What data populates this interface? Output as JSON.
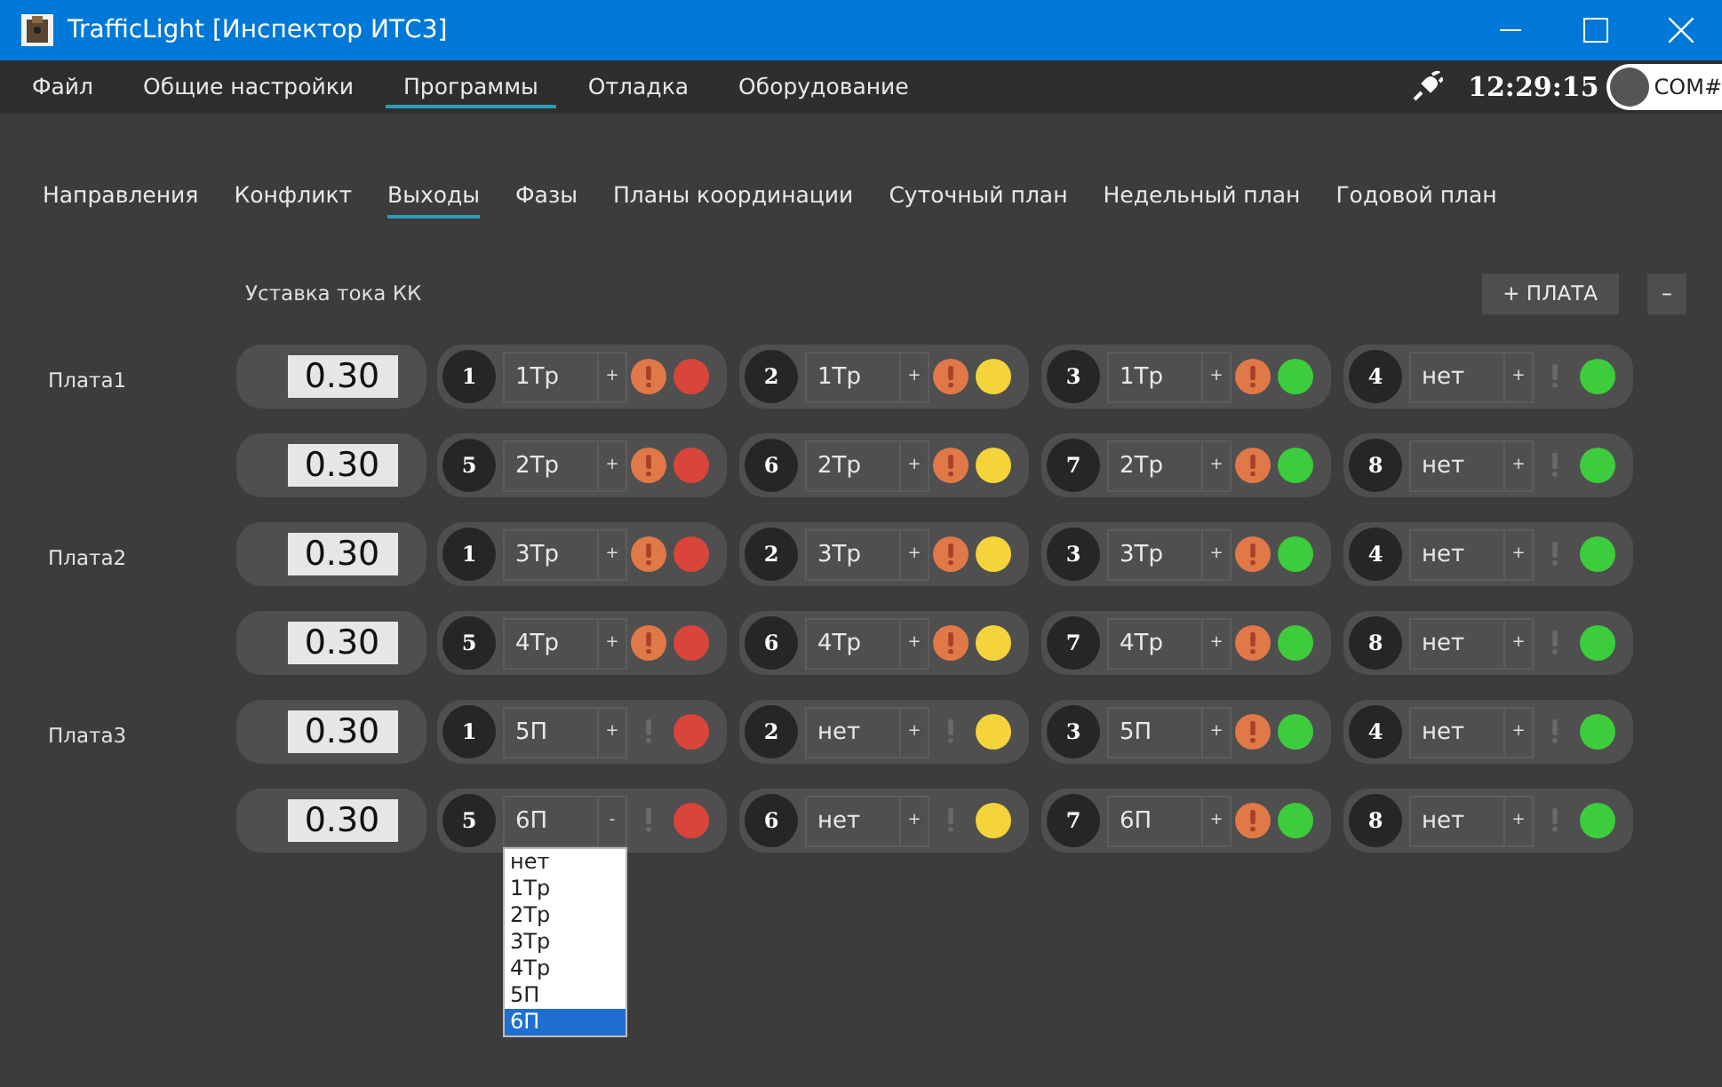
{
  "window": {
    "title": "TrafficLight [Инспектор ИТС3]"
  },
  "menu": [
    {
      "label": "Файл",
      "selected": false
    },
    {
      "label": "Общие настройки",
      "selected": false
    },
    {
      "label": "Программы",
      "selected": true
    },
    {
      "label": "Отладка",
      "selected": false
    },
    {
      "label": "Оборудование",
      "selected": false
    }
  ],
  "status": {
    "time": "12:29:15",
    "port": "COM#",
    "connected": false
  },
  "tabs": [
    {
      "label": "Направления",
      "selected": false
    },
    {
      "label": "Конфликт",
      "selected": false
    },
    {
      "label": "Выходы",
      "selected": true
    },
    {
      "label": "Фазы",
      "selected": false
    },
    {
      "label": "Планы координации",
      "selected": false
    },
    {
      "label": "Суточный план",
      "selected": false
    },
    {
      "label": "Недельный план",
      "selected": false
    },
    {
      "label": "Годовой план",
      "selected": false
    }
  ],
  "current_header": "Уставка тока КК",
  "buttons": {
    "add": "+ ПЛАТА",
    "remove": "–"
  },
  "boards": [
    {
      "label": "Плата1",
      "rows": [
        {
          "current": "0.30",
          "outputs": [
            {
              "num": "1",
              "value": "1Тр",
              "toggle": "+",
              "alarm": true,
              "color": "#d9453a"
            },
            {
              "num": "2",
              "value": "1Тр",
              "toggle": "+",
              "alarm": true,
              "color": "#f5d33a"
            },
            {
              "num": "3",
              "value": "1Тр",
              "toggle": "+",
              "alarm": true,
              "color": "#3ccc3c"
            },
            {
              "num": "4",
              "value": "нет",
              "toggle": "+",
              "alarm": false,
              "color": "#3ccc3c"
            }
          ]
        },
        {
          "current": "0.30",
          "outputs": [
            {
              "num": "5",
              "value": "2Тр",
              "toggle": "+",
              "alarm": true,
              "color": "#d9453a"
            },
            {
              "num": "6",
              "value": "2Тр",
              "toggle": "+",
              "alarm": true,
              "color": "#f5d33a"
            },
            {
              "num": "7",
              "value": "2Тр",
              "toggle": "+",
              "alarm": true,
              "color": "#3ccc3c"
            },
            {
              "num": "8",
              "value": "нет",
              "toggle": "+",
              "alarm": false,
              "color": "#3ccc3c"
            }
          ]
        }
      ]
    },
    {
      "label": "Плата2",
      "rows": [
        {
          "current": "0.30",
          "outputs": [
            {
              "num": "1",
              "value": "3Тр",
              "toggle": "+",
              "alarm": true,
              "color": "#d9453a"
            },
            {
              "num": "2",
              "value": "3Тр",
              "toggle": "+",
              "alarm": true,
              "color": "#f5d33a"
            },
            {
              "num": "3",
              "value": "3Тр",
              "toggle": "+",
              "alarm": true,
              "color": "#3ccc3c"
            },
            {
              "num": "4",
              "value": "нет",
              "toggle": "+",
              "alarm": false,
              "color": "#3ccc3c"
            }
          ]
        },
        {
          "current": "0.30",
          "outputs": [
            {
              "num": "5",
              "value": "4Тр",
              "toggle": "+",
              "alarm": true,
              "color": "#d9453a"
            },
            {
              "num": "6",
              "value": "4Тр",
              "toggle": "+",
              "alarm": true,
              "color": "#f5d33a"
            },
            {
              "num": "7",
              "value": "4Тр",
              "toggle": "+",
              "alarm": true,
              "color": "#3ccc3c"
            },
            {
              "num": "8",
              "value": "нет",
              "toggle": "+",
              "alarm": false,
              "color": "#3ccc3c"
            }
          ]
        }
      ]
    },
    {
      "label": "Плата3",
      "rows": [
        {
          "current": "0.30",
          "outputs": [
            {
              "num": "1",
              "value": "5П",
              "toggle": "+",
              "alarm": false,
              "color": "#d9453a"
            },
            {
              "num": "2",
              "value": "нет",
              "toggle": "+",
              "alarm": false,
              "color": "#f5d33a"
            },
            {
              "num": "3",
              "value": "5П",
              "toggle": "+",
              "alarm": true,
              "color": "#3ccc3c"
            },
            {
              "num": "4",
              "value": "нет",
              "toggle": "+",
              "alarm": false,
              "color": "#3ccc3c"
            }
          ]
        },
        {
          "current": "0.30",
          "outputs": [
            {
              "num": "5",
              "value": "6П",
              "toggle": "-",
              "alarm": false,
              "color": "#d9453a",
              "options": [
                {
                  "label": "нет",
                  "selected": false
                },
                {
                  "label": "1Тр",
                  "selected": false
                },
                {
                  "label": "2Тр",
                  "selected": false
                },
                {
                  "label": "3Тр",
                  "selected": false
                },
                {
                  "label": "4Тр",
                  "selected": false
                },
                {
                  "label": "5П",
                  "selected": false
                },
                {
                  "label": "6П",
                  "selected": true
                }
              ]
            },
            {
              "num": "6",
              "value": "нет",
              "toggle": "+",
              "alarm": false,
              "color": "#f5d33a"
            },
            {
              "num": "7",
              "value": "6П",
              "toggle": "+",
              "alarm": true,
              "color": "#3ccc3c"
            },
            {
              "num": "8",
              "value": "нет",
              "toggle": "+",
              "alarm": false,
              "color": "#3ccc3c"
            }
          ]
        }
      ]
    }
  ]
}
